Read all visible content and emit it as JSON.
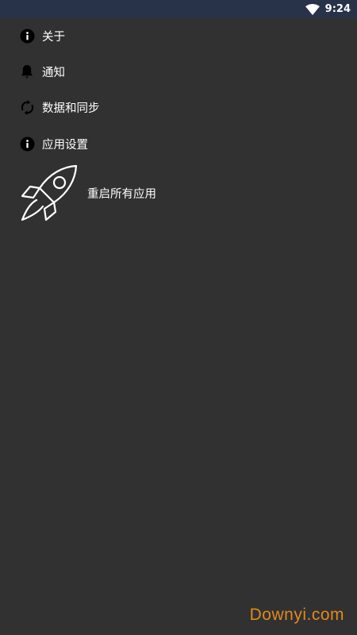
{
  "status_bar": {
    "time": "9:24",
    "wifi_icon": "wifi-icon"
  },
  "menu": {
    "items": [
      {
        "label": "关于",
        "icon": "info-icon"
      },
      {
        "label": "通知",
        "icon": "bell-icon"
      },
      {
        "label": "数据和同步",
        "icon": "sync-icon"
      },
      {
        "label": "应用设置",
        "icon": "info-icon"
      }
    ],
    "restart": {
      "label": "重启所有应用",
      "icon": "rocket-icon"
    }
  },
  "watermark": "Downyi.com",
  "colors": {
    "background": "#313131",
    "status_bar": "#283248",
    "text": "#ffffff",
    "watermark": "#e08a1e"
  }
}
